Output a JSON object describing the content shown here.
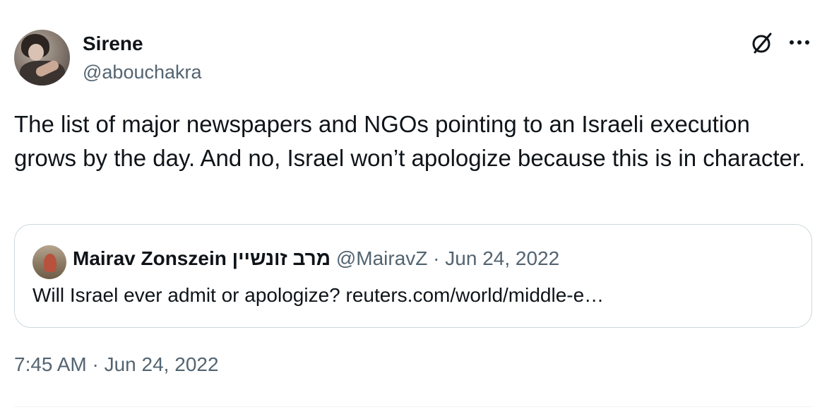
{
  "author": {
    "display_name": "Sirene",
    "handle": "@abouchakra"
  },
  "tweet": {
    "text": "The list of major newspapers and NGOs pointing to an Israeli execution grows by the day. And no, Israel won’t apologize because this is in character."
  },
  "quoted_tweet": {
    "display_name": "Mairav Zonszein מרב זונשיין",
    "handle": "@MairavZ",
    "separator": "·",
    "date": "Jun 24, 2022",
    "text": "Will Israel ever admit or apologize? reuters.com/world/middle-e…"
  },
  "timestamp": "7:45 AM · Jun 24, 2022",
  "icons": {
    "grok": "grok-icon",
    "more": "more-options-icon"
  },
  "colors": {
    "text_primary": "#0f1419",
    "text_secondary": "#536471",
    "border": "#cfd9de"
  }
}
